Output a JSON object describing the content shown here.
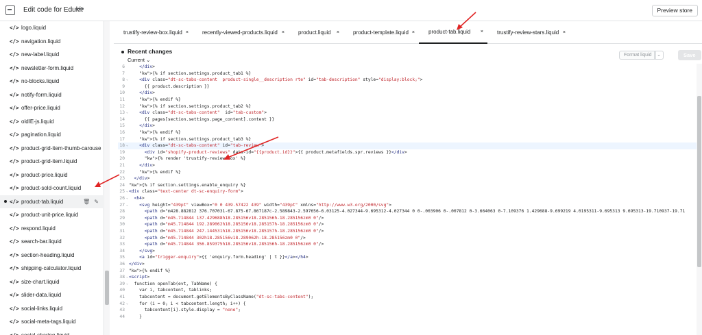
{
  "topbar": {
    "title": "Edit code for Edukit",
    "more": "•••",
    "preview_label": "Preview store"
  },
  "sidebar": {
    "items": [
      {
        "label": "logo.liquid"
      },
      {
        "label": "navigation.liquid"
      },
      {
        "label": "new-label.liquid"
      },
      {
        "label": "newsletter-form.liquid"
      },
      {
        "label": "no-blocks.liquid"
      },
      {
        "label": "notify-form.liquid"
      },
      {
        "label": "offer-price.liquid"
      },
      {
        "label": "oldIE-js.liquid"
      },
      {
        "label": "pagination.liquid"
      },
      {
        "label": "product-grid-item-thumb-carousel.liquid"
      },
      {
        "label": "product-grid-item.liquid"
      },
      {
        "label": "product-price.liquid"
      },
      {
        "label": "product-sold-count.liquid"
      },
      {
        "label": "product-tab.liquid",
        "active": true
      },
      {
        "label": "product-unit-price.liquid"
      },
      {
        "label": "respond.liquid"
      },
      {
        "label": "search-bar.liquid"
      },
      {
        "label": "section-heading.liquid"
      },
      {
        "label": "shipping-calculator.liquid"
      },
      {
        "label": "size-chart.liquid"
      },
      {
        "label": "slider-data.liquid"
      },
      {
        "label": "social-links.liquid"
      },
      {
        "label": "social-meta-tags.liquid"
      },
      {
        "label": "social-sharing.liquid"
      }
    ],
    "file_icon": "</>",
    "delete_icon": "🗑",
    "edit_icon": "✎"
  },
  "tabs": [
    {
      "label": "trustify-review-box.liquid"
    },
    {
      "label": "recently-viewed-products.liquid"
    },
    {
      "label": "product.liquid"
    },
    {
      "label": "product-template.liquid"
    },
    {
      "label": "product-tab.liquid",
      "active": true
    },
    {
      "label": "trustify-review-stars.liquid"
    }
  ],
  "tab_close": "×",
  "recent": {
    "title": "Recent changes",
    "select": "Current ⌄",
    "format_label": "Format liquid",
    "format_caret": "⌄",
    "save_label": "Save"
  },
  "code_lines": [
    {
      "n": "6",
      "t": "    </div>"
    },
    {
      "n": "7",
      "t": "    {% if section.settings.product_tab1 %}"
    },
    {
      "n": "8",
      "f": true,
      "t": "    <div class=\"dt-sc-tabs-content  product-single__description rte\" id=\"tab-description\" style=\"display:block;\">"
    },
    {
      "n": "9",
      "t": "      {{ product.description }}"
    },
    {
      "n": "10",
      "t": "    </div>"
    },
    {
      "n": "11",
      "t": "    {% endif %}"
    },
    {
      "n": "12",
      "t": "    {% if section.settings.product_tab2 %}"
    },
    {
      "n": "13",
      "f": true,
      "t": "    <div class=\"dt-sc-tabs-content\"  id=\"tab-custom\">"
    },
    {
      "n": "14",
      "t": "      {{ pages[section.settings.page_content].content }}"
    },
    {
      "n": "15",
      "t": "    </div>"
    },
    {
      "n": "16",
      "t": "    {% endif %}"
    },
    {
      "n": "17",
      "t": "    {% if section.settings.product_tab3 %}"
    },
    {
      "n": "18",
      "f": true,
      "hl": true,
      "t": "    <div class=\"dt-sc-tabs-content\" id=\"tab-review\">"
    },
    {
      "n": "19",
      "t": "      <div id=\"shopify-product-reviews\" data-id=\"{{product.id}}\">{{ product.metafields.spr.reviews }}</div>"
    },
    {
      "n": "20",
      "t": "      {% render 'trustify-review-box' %}"
    },
    {
      "n": "21",
      "t": "    </div>"
    },
    {
      "n": "22",
      "t": "    {% endif %}"
    },
    {
      "n": "23",
      "t": "  </div>"
    },
    {
      "n": "24",
      "t": "{% if section.settings.enable_enquiry %}"
    },
    {
      "n": "25",
      "f": true,
      "t": "<div class=\"text-center dt-sc-enquiry-form\">"
    },
    {
      "n": "26",
      "f": true,
      "t": "  <h4>"
    },
    {
      "n": "27",
      "f": true,
      "t": "    <svg height=\"439pt\" viewBox=\"0 0 439.57422 439\" width=\"439pt\" xmlns=\"http://www.w3.org/2000/svg\">"
    },
    {
      "n": "28",
      "t": "      <path d=\"m428.882812 376.707031-67.875-67.867187c-2.589843-2.597656-6.03125-4.027344-9.695312-4.027344 0 0-.003906 0-.007812 0-3.664063 0-7.109376 1.429688-9.699219 4.0195311-9.695313 9.695313-19.710937-19.71"
    },
    {
      "n": "29",
      "t": "      <path d=\"m45.714844 137.429688h18.285156v18.285156h-18.285156zm0 0\"/>"
    },
    {
      "n": "30",
      "t": "      <path d=\"m45.714844 192.289062h18.285156v18.285157h-18.285156zm0 0\"/>"
    },
    {
      "n": "31",
      "t": "      <path d=\"m45.714844 247.144531h18.285156v18.285157h-18.285156zm0 0\"/>"
    },
    {
      "n": "32",
      "t": "      <path d=\"m45.714844 302h18.285156v18.289062h-18.285156zm0 0\"/>"
    },
    {
      "n": "33",
      "t": "      <path d=\"m45.714844 356.859375h18.285156v18.285156h-18.285156zm0 0\"/>"
    },
    {
      "n": "34",
      "t": "    </svg>"
    },
    {
      "n": "35",
      "t": "    <a id=\"trigger-enquiry\">{{ 'enquiry.form.heading' | t }}</a></h4>"
    },
    {
      "n": "36",
      "t": "</div>"
    },
    {
      "n": "37",
      "t": "{% endif %}"
    },
    {
      "n": "38",
      "f": true,
      "t": "<script>"
    },
    {
      "n": "39",
      "f": true,
      "t": "  function openTab(evt, TabName) {"
    },
    {
      "n": "40",
      "t": "    var i, tabcontent, tablinks;"
    },
    {
      "n": "41",
      "t": "    tabcontent = document.getElementsByClassName(\"dt-sc-tabs-content\");"
    },
    {
      "n": "42",
      "f": true,
      "t": "    for (i = 0; i < tabcontent.length; i++) {"
    },
    {
      "n": "43",
      "t": "      tabcontent[i].style.display = \"none\";"
    },
    {
      "n": "44",
      "t": "    }"
    }
  ],
  "colors": {
    "accent_arrow": "#e02424",
    "highlight_line": "#edf5ff"
  }
}
